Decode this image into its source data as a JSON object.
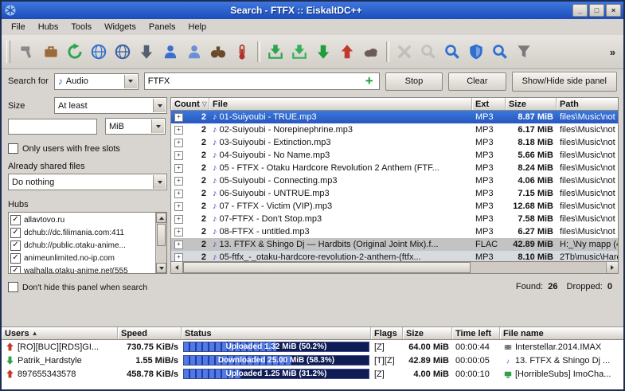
{
  "window": {
    "title": "Search - FTFX :: EiskaltDC++",
    "controls": {
      "minimize": "_",
      "maximize": "□",
      "close": "×"
    }
  },
  "menubar": {
    "items": [
      "File",
      "Hubs",
      "Tools",
      "Widgets",
      "Panels",
      "Help"
    ]
  },
  "toolbar": {
    "overflow": "»",
    "icons": [
      {
        "name": "settings-hammer-icon",
        "kind": "hammer",
        "color": "#8a8a8a",
        "disabled": false
      },
      {
        "name": "connect-icon",
        "kind": "briefcase",
        "color": "#9a6a3a",
        "disabled": false
      },
      {
        "name": "reload-icon",
        "kind": "refresh",
        "color": "#2da44e",
        "disabled": false
      },
      {
        "name": "favorite-hubs-globe-icon",
        "kind": "globe",
        "color": "#2f6fd0",
        "disabled": false
      },
      {
        "name": "public-hubs-globe-icon",
        "kind": "globe",
        "color": "#3a5fa0",
        "disabled": false
      },
      {
        "name": "download-queue-icon",
        "kind": "arrow-down",
        "color": "#55606e",
        "disabled": false
      },
      {
        "name": "favorite-users-icon",
        "kind": "person",
        "color": "#3a6fd0",
        "disabled": false
      },
      {
        "name": "users-icon",
        "kind": "person",
        "color": "#6a8fd8",
        "disabled": false
      },
      {
        "name": "search-binoculars-icon",
        "kind": "binoculars",
        "color": "#6b4a2a",
        "disabled": false
      },
      {
        "name": "spy-gauge-icon",
        "kind": "gauge",
        "color": "#b0332a",
        "disabled": false,
        "sep_after": true
      },
      {
        "name": "finished-downloads-icon",
        "kind": "box-down",
        "color": "#2da44e",
        "disabled": false
      },
      {
        "name": "finished-uploads-icon",
        "kind": "box-down",
        "color": "#35b058",
        "disabled": false
      },
      {
        "name": "download-arrow-icon",
        "kind": "arrow-down",
        "color": "#1f9d3a",
        "disabled": false
      },
      {
        "name": "upload-arrow-icon",
        "kind": "arrow-up",
        "color": "#c03a2a",
        "disabled": false
      },
      {
        "name": "hub-cloud-icon",
        "kind": "cloud",
        "color": "#6e5a5a",
        "disabled": false,
        "sep_after": true
      },
      {
        "name": "close-disabled-icon",
        "kind": "cross",
        "color": "#9a9a9a",
        "disabled": true
      },
      {
        "name": "search-disabled-icon",
        "kind": "magnifier",
        "color": "#9a9a9a",
        "disabled": true
      },
      {
        "name": "search-spy-icon",
        "kind": "magnifier",
        "color": "#2f6fd0",
        "disabled": false
      },
      {
        "name": "adl-shield-icon",
        "kind": "shield",
        "color": "#2f6fd0",
        "disabled": false
      },
      {
        "name": "quick-search-icon",
        "kind": "magnifier",
        "color": "#2f6fd0",
        "disabled": false
      },
      {
        "name": "filter-funnel-icon",
        "kind": "funnel",
        "color": "#7a7a7a",
        "disabled": false
      }
    ]
  },
  "search": {
    "label": "Search for",
    "type_value": "Audio",
    "query": "FTFX",
    "add_label": "+",
    "stop_label": "Stop",
    "clear_label": "Clear",
    "side_panel_label": "Show/Hide side panel"
  },
  "sidebar": {
    "size_label": "Size",
    "size_mode_value": "At least",
    "size_value": "",
    "size_unit_value": "MiB",
    "free_slots_label": "Only users with free slots",
    "shared_files_label": "Already shared files",
    "shared_files_value": "Do nothing",
    "hubs_label": "Hubs",
    "hubs": [
      {
        "label": "allavtovo.ru",
        "checked": true
      },
      {
        "label": "dchub://dc.filimania.com:411",
        "checked": true
      },
      {
        "label": "dchub://public.otaku-anime...",
        "checked": true
      },
      {
        "label": "animeunlimited.no-ip.com",
        "checked": true
      },
      {
        "label": "walhalla.otaku-anime.net(555",
        "checked": true
      }
    ],
    "dont_hide_label": "Don't hide this panel when search"
  },
  "results": {
    "columns": {
      "count": "Count",
      "file": "File",
      "ext": "Ext",
      "size": "Size",
      "path": "Path"
    },
    "sort_indicator": "▽",
    "rows": [
      {
        "count": "2",
        "file": "01-Suiyoubi - TRUE.mp3",
        "ext": "MP3",
        "size": "8.87 MiB",
        "path": "files\\Music\\not",
        "selected": true
      },
      {
        "count": "2",
        "file": "02-Suiyoubi - Norepinephrine.mp3",
        "ext": "MP3",
        "size": "6.17 MiB",
        "path": "files\\Music\\not"
      },
      {
        "count": "2",
        "file": "03-Suiyoubi - Extinction.mp3",
        "ext": "MP3",
        "size": "8.18 MiB",
        "path": "files\\Music\\not"
      },
      {
        "count": "2",
        "file": "04-Suiyoubi - No Name.mp3",
        "ext": "MP3",
        "size": "5.66 MiB",
        "path": "files\\Music\\not"
      },
      {
        "count": "2",
        "file": "05 - FTFX - Otaku Hardcore Revolution 2 Anthem (FTF...",
        "ext": "MP3",
        "size": "8.24 MiB",
        "path": "files\\Music\\not"
      },
      {
        "count": "2",
        "file": "05-Suiyoubi - Connecting.mp3",
        "ext": "MP3",
        "size": "4.06 MiB",
        "path": "files\\Music\\not"
      },
      {
        "count": "2",
        "file": "06-Suiyoubi - UNTRUE.mp3",
        "ext": "MP3",
        "size": "7.15 MiB",
        "path": "files\\Music\\not"
      },
      {
        "count": "2",
        "file": "07 - FTFX - Victim (VIP).mp3",
        "ext": "MP3",
        "size": "12.68 MiB",
        "path": "files\\Music\\not"
      },
      {
        "count": "2",
        "file": "07-FTFX - Don't Stop.mp3",
        "ext": "MP3",
        "size": "7.58 MiB",
        "path": "files\\Music\\not"
      },
      {
        "count": "2",
        "file": "08-FTFX - untitled.mp3",
        "ext": "MP3",
        "size": "6.27 MiB",
        "path": "files\\Music\\not"
      },
      {
        "count": "2",
        "file": "13. FTFX & Shingo Dj — Hardbits (Original Joint Mix).f...",
        "ext": "FLAC",
        "size": "42.89 MiB",
        "path": "H:_\\Ny mapp (4",
        "shaded": true
      },
      {
        "count": "2",
        "file": "05-ftfx_-_otaku-hardcore-revolution-2-anthem-(ftfx...",
        "ext": "MP3",
        "size": "8.10 MiB",
        "path": "2Tb\\music\\Hard",
        "shaded2": true
      }
    ],
    "found_label": "Found:",
    "found_value": "26",
    "dropped_label": "Dropped:",
    "dropped_value": "0"
  },
  "transfers": {
    "sort_indicator": "▲",
    "columns": {
      "users": "Users",
      "speed": "Speed",
      "status": "Status",
      "flags": "Flags",
      "size": "Size",
      "time_left": "Time left",
      "file_name": "File name"
    },
    "rows": [
      {
        "dir": "up",
        "user": "[RO][BUC][RDS]GI...",
        "speed": "730.75 KiB/s",
        "status": "Uploaded 1.32 MiB (50.2%)",
        "pct": 50.2,
        "flags": "[Z]",
        "size": "64.00 MiB",
        "time_left": "00:00:44",
        "file_icon": "film",
        "file": "Interstellar.2014.IMAX"
      },
      {
        "dir": "down",
        "user": "Patrik_Hardstyle",
        "speed": "1.55 MiB/s",
        "status": "Downloaded 25.00 MiB (58.3%)",
        "pct": 58.3,
        "flags": "[T][Z]",
        "size": "42.89 MiB",
        "time_left": "00:00:05",
        "file_icon": "note",
        "file": "13. FTFX & Shingo Dj ..."
      },
      {
        "dir": "up",
        "user": "897655343578",
        "speed": "458.78 KiB/s",
        "status": "Uploaded 1.25 MiB (31.2%)",
        "pct": 31.2,
        "flags": "[Z]",
        "size": "4.00 MiB",
        "time_left": "00:00:10",
        "file_icon": "tv",
        "file": "[HorribleSubs] ImoCha..."
      }
    ]
  }
}
